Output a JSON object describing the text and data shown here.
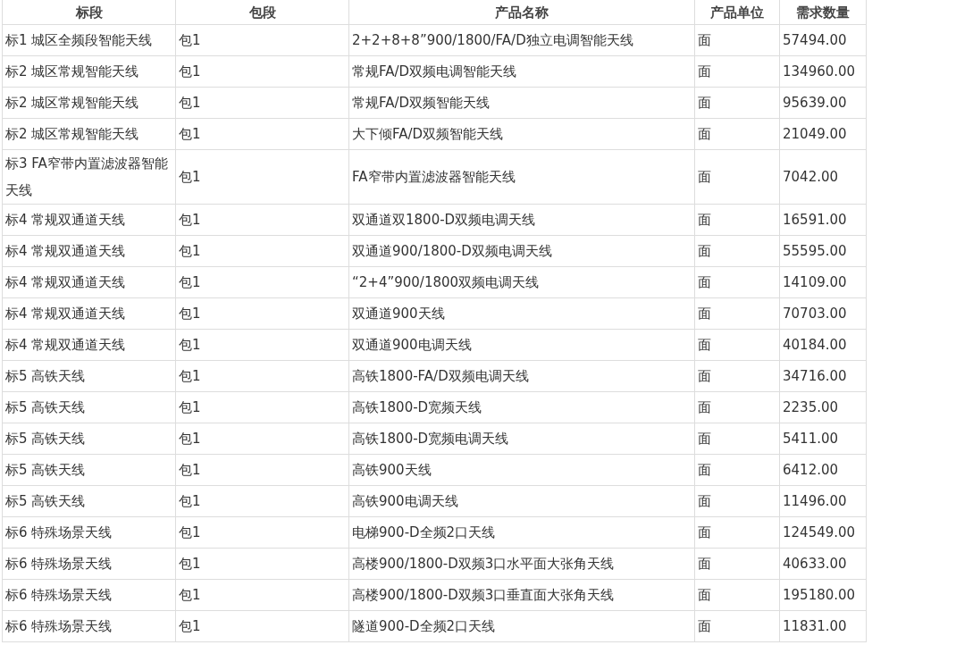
{
  "table": {
    "columns": [
      "标段",
      "包段",
      "产品名称",
      "产品单位",
      "需求数量"
    ],
    "rows": [
      [
        "标1 城区全频段智能天线",
        "包1",
        "2+2+8+8”900/1800/FA/D独立电调智能天线",
        "面",
        "57494.00"
      ],
      [
        "标2 城区常规智能天线",
        "包1",
        "常规FA/D双频电调智能天线",
        "面",
        "134960.00"
      ],
      [
        "标2 城区常规智能天线",
        "包1",
        "常规FA/D双频智能天线",
        "面",
        "95639.00"
      ],
      [
        "标2 城区常规智能天线",
        "包1",
        "大下倾FA/D双频智能天线",
        "面",
        "21049.00"
      ],
      [
        "标3 FA窄带内置滤波器智能天线",
        "包1",
        "FA窄带内置滤波器智能天线",
        "面",
        "7042.00"
      ],
      [
        "标4 常规双通道天线",
        "包1",
        "双通道双1800-D双频电调天线",
        "面",
        "16591.00"
      ],
      [
        "标4 常规双通道天线",
        "包1",
        "双通道900/1800-D双频电调天线",
        "面",
        "55595.00"
      ],
      [
        "标4 常规双通道天线",
        "包1",
        "“2+4”900/1800双频电调天线",
        "面",
        "14109.00"
      ],
      [
        "标4 常规双通道天线",
        "包1",
        "双通道900天线",
        "面",
        "70703.00"
      ],
      [
        "标4 常规双通道天线",
        "包1",
        "双通道900电调天线",
        "面",
        "40184.00"
      ],
      [
        "标5 高铁天线",
        "包1",
        "高铁1800-FA/D双频电调天线",
        "面",
        "34716.00"
      ],
      [
        "标5 高铁天线",
        "包1",
        "高铁1800-D宽频天线",
        "面",
        "2235.00"
      ],
      [
        "标5 高铁天线",
        "包1",
        "高铁1800-D宽频电调天线",
        "面",
        "5411.00"
      ],
      [
        "标5 高铁天线",
        "包1",
        "高铁900天线",
        "面",
        "6412.00"
      ],
      [
        "标5 高铁天线",
        "包1",
        "高铁900电调天线",
        "面",
        "11496.00"
      ],
      [
        "标6 特殊场景天线",
        "包1",
        "电梯900-D全频2口天线",
        "面",
        "124549.00"
      ],
      [
        "标6 特殊场景天线",
        "包1",
        "高楼900/1800-D双频3口水平面大张角天线",
        "面",
        "40633.00"
      ],
      [
        "标6 特殊场景天线",
        "包1",
        "高楼900/1800-D双频3口垂直面大张角天线",
        "面",
        "195180.00"
      ],
      [
        "标6 特殊场景天线",
        "包1",
        "隧道900-D全频2口天线",
        "面",
        "11831.00"
      ]
    ]
  }
}
